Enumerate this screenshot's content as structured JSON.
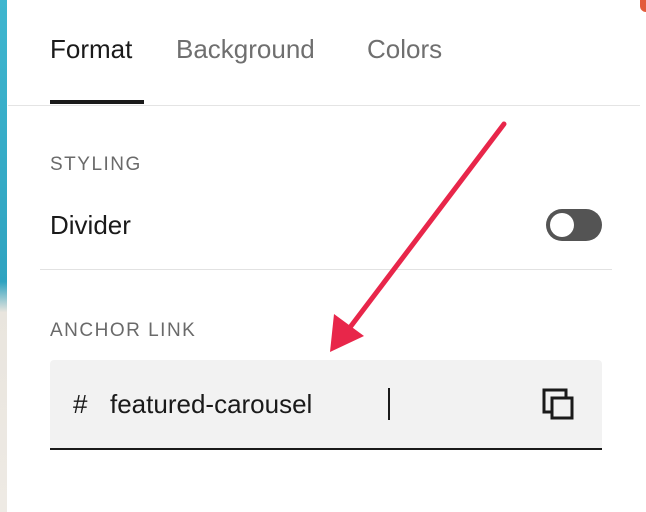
{
  "tabs": [
    {
      "label": "Format",
      "active": true
    },
    {
      "label": "Background",
      "active": false
    },
    {
      "label": "Colors",
      "active": false
    }
  ],
  "styling": {
    "section_label": "STYLING",
    "divider_label": "Divider",
    "divider_enabled": false
  },
  "anchor": {
    "section_label": "ANCHOR LINK",
    "prefix": "#",
    "value": "featured-carousel"
  },
  "icons": {
    "copy": "copy-icon",
    "annotation_arrow": "arrow-annotation"
  },
  "colors": {
    "annotation_arrow": "#e8264a",
    "toggle_off": "#545454",
    "field_background": "#f2f2f2",
    "text_primary": "#1a1a1a",
    "text_muted": "#6f6f6f"
  }
}
